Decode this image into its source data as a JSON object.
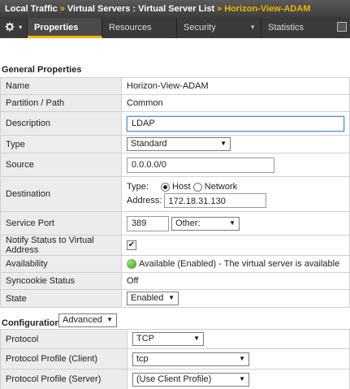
{
  "breadcrumb": {
    "items": [
      "Local Traffic",
      "Virtual Servers : Virtual Server List",
      "Horizon-View-ADAM"
    ],
    "separator": "»"
  },
  "tabs": {
    "gear_caret": "▾",
    "items": [
      {
        "label": "Properties",
        "active": true
      },
      {
        "label": "Resources",
        "active": false
      },
      {
        "label": "Security",
        "active": false
      },
      {
        "label": "Statistics",
        "active": false
      }
    ]
  },
  "general": {
    "title": "General Properties",
    "name_label": "Name",
    "name_value": "Horizon-View-ADAM",
    "partition_label": "Partition / Path",
    "partition_value": "Common",
    "description_label": "Description",
    "description_value": "LDAP",
    "type_label": "Type",
    "type_value": "Standard",
    "source_label": "Source",
    "source_value": "0.0.0.0/0",
    "destination_label": "Destination",
    "destination_type_label": "Type:",
    "destination_host_label": "Host",
    "destination_network_label": "Network",
    "destination_address_label": "Address:",
    "destination_address_value": "172.18.31.130",
    "service_port_label": "Service Port",
    "service_port_value": "389",
    "service_port_select": "Other:",
    "notify_label": "Notify Status to Virtual Address",
    "notify_checked": "✔",
    "availability_label": "Availability",
    "availability_value": "Available (Enabled) - The virtual server is available",
    "syncookie_label": "Syncookie Status",
    "syncookie_value": "Off",
    "state_label": "State",
    "state_value": "Enabled"
  },
  "configuration": {
    "title": "Configuration:",
    "mode_value": "Advanced",
    "protocol_label": "Protocol",
    "protocol_value": "TCP",
    "profile_client_label": "Protocol Profile (Client)",
    "profile_client_value": "tcp",
    "profile_server_label": "Protocol Profile (Server)",
    "profile_server_value": "(Use Client Profile)"
  },
  "colors": {
    "accent": "#f0b400",
    "header_bg": "#3c3c3c",
    "label_bg": "#ececec",
    "status_green": "#3a9a1a"
  }
}
